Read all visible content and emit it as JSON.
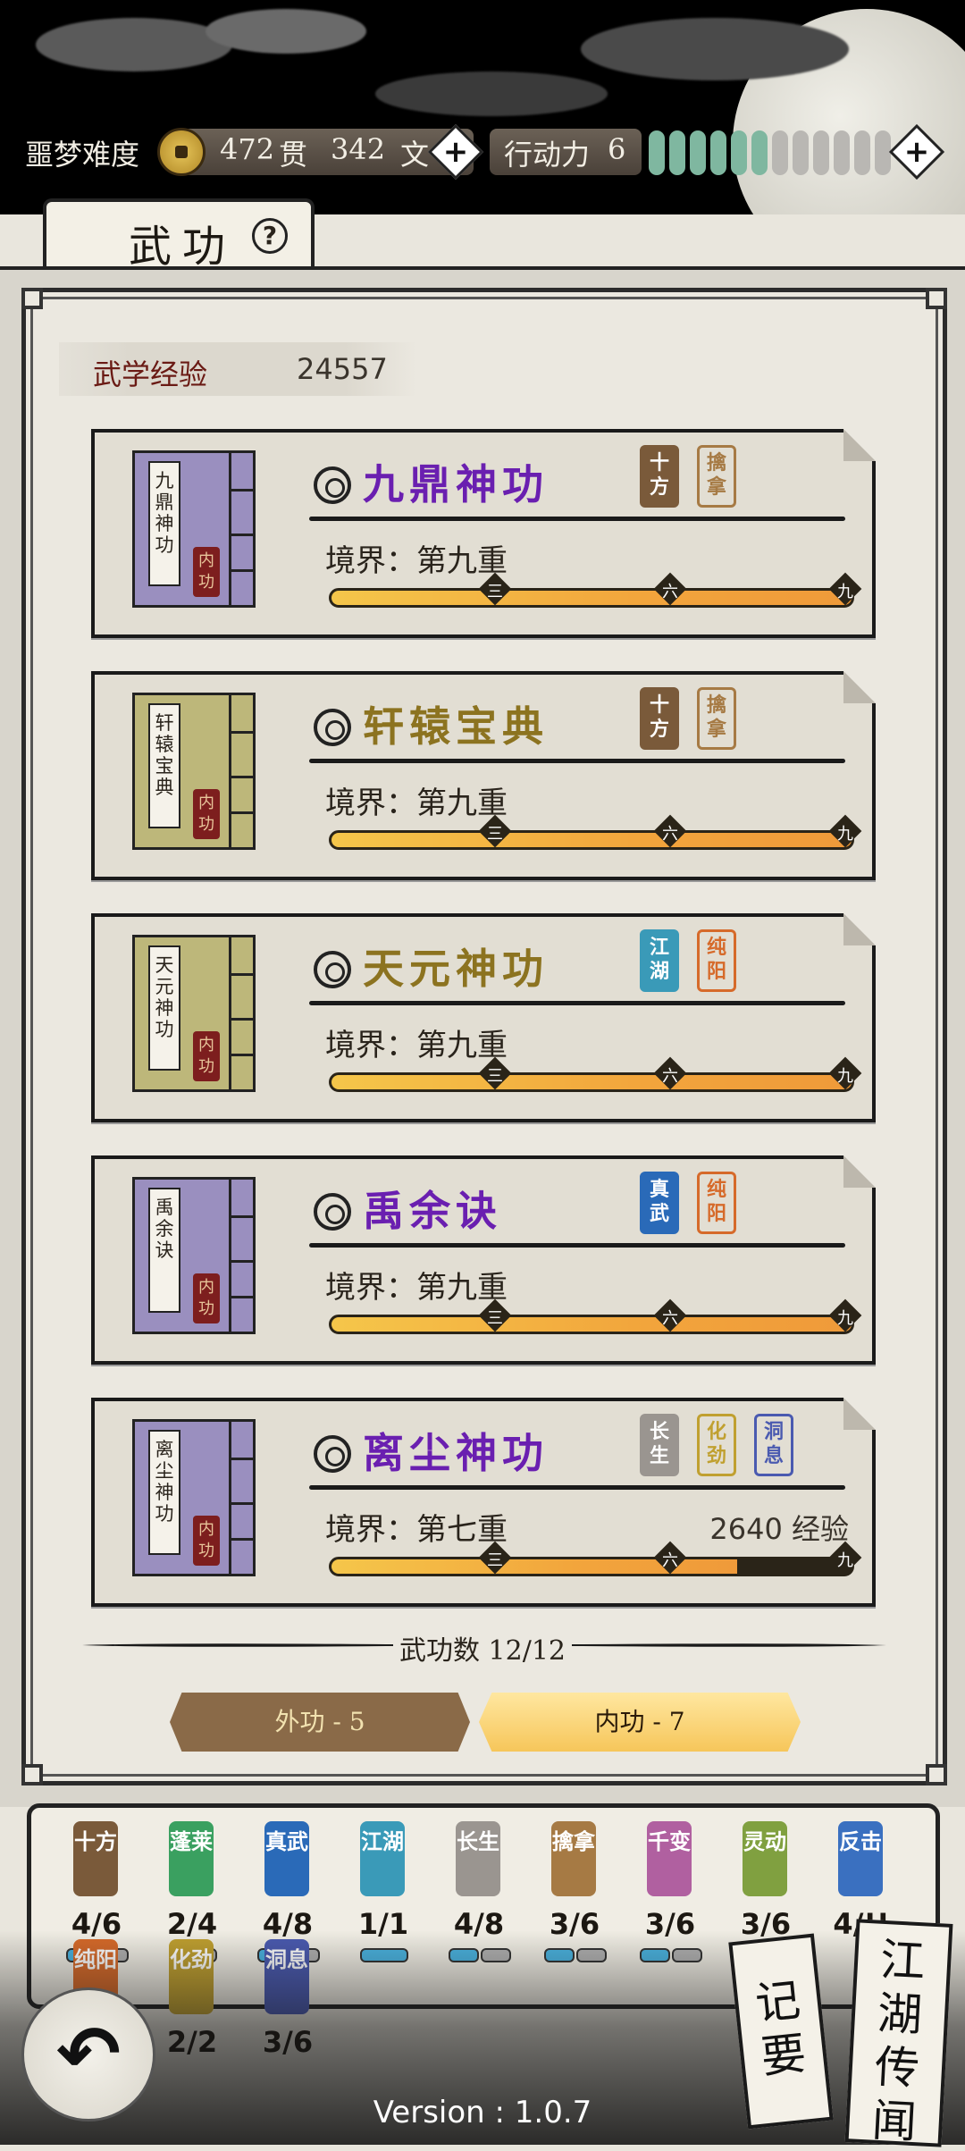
{
  "topbar": {
    "difficulty": "噩梦难度",
    "guan_amount": "472",
    "guan_unit": "贯",
    "wen_amount": "342",
    "wen_unit": "文",
    "stamina_label": "行动力",
    "stamina_value": "6",
    "stamina_segments_filled": 6,
    "stamina_segments_total": 12,
    "plus_symbol": "+"
  },
  "tab": {
    "title": "武功",
    "help": "?"
  },
  "experience": {
    "label": "武学经验",
    "value": "24557"
  },
  "skills": [
    {
      "book_title": "九鼎神功",
      "tag": "内功",
      "name": "九鼎神功",
      "name_color": "#6a1fb0",
      "book_color": "#9a8fbf",
      "realm": "境界：第九重",
      "exp": "",
      "progress": 1.0,
      "stamps": [
        {
          "text": "十方",
          "color": "#7a5a3a",
          "fill": true
        },
        {
          "text": "擒拿",
          "color": "#a67a44",
          "fill": false
        }
      ]
    },
    {
      "book_title": "轩辕宝典",
      "tag": "内功",
      "name": "轩辕宝典",
      "name_color": "#8c7320",
      "book_color": "#bdb77a",
      "realm": "境界：第九重",
      "exp": "",
      "progress": 1.0,
      "stamps": [
        {
          "text": "十方",
          "color": "#7a5a3a",
          "fill": true
        },
        {
          "text": "擒拿",
          "color": "#a67a44",
          "fill": false
        }
      ]
    },
    {
      "book_title": "天元神功",
      "tag": "内功",
      "name": "天元神功",
      "name_color": "#8c7320",
      "book_color": "#bdb77a",
      "realm": "境界：第九重",
      "exp": "",
      "progress": 1.0,
      "stamps": [
        {
          "text": "江湖",
          "color": "#3a9ab8",
          "fill": true
        },
        {
          "text": "纯阳",
          "color": "#d66a2a",
          "fill": false
        }
      ]
    },
    {
      "book_title": "禹余诀",
      "tag": "内功",
      "name": "禹余诀",
      "name_color": "#6a1fb0",
      "book_color": "#9a8fbf",
      "realm": "境界：第九重",
      "exp": "",
      "progress": 1.0,
      "stamps": [
        {
          "text": "真武",
          "color": "#2a6ab8",
          "fill": true
        },
        {
          "text": "纯阳",
          "color": "#d66a2a",
          "fill": false
        }
      ]
    },
    {
      "book_title": "离尘神功",
      "tag": "内功",
      "name": "离尘神功",
      "name_color": "#6a1fb0",
      "book_color": "#9a8fbf",
      "realm": "境界：第七重",
      "exp": "2640 经验",
      "progress": 0.78,
      "stamps": [
        {
          "text": "长生",
          "color": "#9a9590",
          "fill": true
        },
        {
          "text": "化劲",
          "color": "#c0a030",
          "fill": false
        },
        {
          "text": "洞息",
          "color": "#4a5ab0",
          "fill": false
        }
      ]
    }
  ],
  "progress_marks": [
    "三",
    "六",
    "九"
  ],
  "footer": {
    "count": "武功数 12/12",
    "outer_button": "外功 - 5",
    "inner_button": "内功 - 7"
  },
  "legend": [
    {
      "text": "十方",
      "count": "4/6",
      "color": "#7a5a3a"
    },
    {
      "text": "蓬莱",
      "count": "2/4",
      "color": "#3aa060"
    },
    {
      "text": "真武",
      "count": "4/8",
      "color": "#2a6ab8"
    },
    {
      "text": "江湖",
      "count": "1/1",
      "color": "#3a9ab8"
    },
    {
      "text": "长生",
      "count": "4/8",
      "color": "#9a9590"
    },
    {
      "text": "擒拿",
      "count": "3/6",
      "color": "#a67a44"
    },
    {
      "text": "千变",
      "count": "3/6",
      "color": "#b060a0"
    },
    {
      "text": "灵动",
      "count": "3/6",
      "color": "#80a040"
    },
    {
      "text": "反击",
      "count": "4/!!",
      "color": "#3a70c0"
    },
    {
      "text": "纯阳",
      "count": "",
      "color": "#d66a2a"
    },
    {
      "text": "化劲",
      "count": "2/2",
      "color": "#c0a030"
    },
    {
      "text": "洞息",
      "count": "3/6",
      "color": "#4a5ab0"
    }
  ],
  "side_buttons": {
    "notes": "记要",
    "rumors": "江湖传闻"
  },
  "version": "Version : 1.0.7"
}
